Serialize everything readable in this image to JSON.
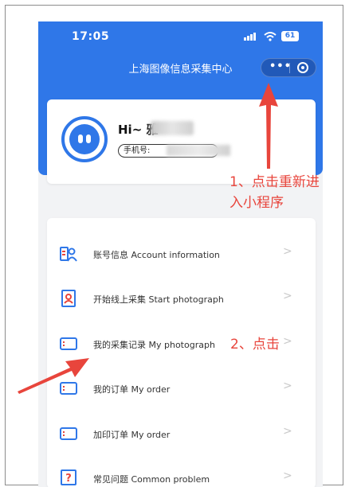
{
  "status_bar": {
    "time": "17:05",
    "battery": "61"
  },
  "header": {
    "title": "上海图像信息采集中心"
  },
  "profile": {
    "greeting": "Hi~",
    "name_partial": "雅",
    "phone_label": "手机号:"
  },
  "menu": {
    "items": [
      {
        "label": "账号信息 Account information",
        "icon": "account-info-icon"
      },
      {
        "label": "开始线上采集 Start photograph",
        "icon": "start-photograph-icon"
      },
      {
        "label": "我的采集记录 My photograph",
        "icon": "my-photograph-icon"
      },
      {
        "label": "我的订单 My order",
        "icon": "my-order-icon"
      },
      {
        "label": "加印订单 My order",
        "icon": "reprint-order-icon"
      },
      {
        "label": "常见问题 Common problem",
        "icon": "help-icon"
      }
    ],
    "chevron": ">"
  },
  "annotations": {
    "step1_line1": "1、点击重新进",
    "step1_line2": "入小程序",
    "step2": "2、点击"
  },
  "colors": {
    "brand": "#2f77e8",
    "annotation": "#e8453c"
  }
}
